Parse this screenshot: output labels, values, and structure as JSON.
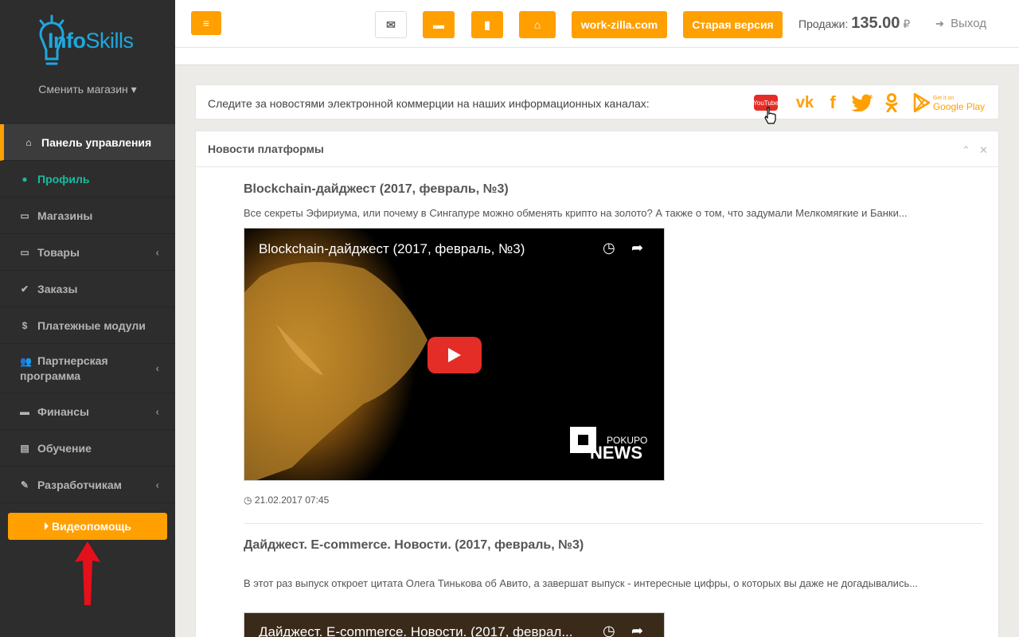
{
  "sidebar": {
    "logo": {
      "info": "Info",
      "skills": "Skills"
    },
    "change_shop": "Сменить магазин ▾",
    "items": [
      {
        "label": "Панель управления",
        "icon": "home-icon"
      },
      {
        "label": "Профиль",
        "icon": "user-icon"
      },
      {
        "label": "Магазины",
        "icon": "cart-icon"
      },
      {
        "label": "Товары",
        "icon": "cart-icon"
      },
      {
        "label": "Заказы",
        "icon": "check-icon"
      },
      {
        "label": "Платежные модули",
        "icon": "dollar-icon"
      },
      {
        "label": "Партнерская программа",
        "icon": "users-icon"
      },
      {
        "label": "Финансы",
        "icon": "archive-icon"
      },
      {
        "label": "Обучение",
        "icon": "book-icon"
      },
      {
        "label": "Разработчикам",
        "icon": "plug-icon"
      }
    ],
    "video_help": "Видеопомощь"
  },
  "topbar": {
    "workzilla": "work-zilla.com",
    "old_version": "Старая версия",
    "sales_label": "Продажи:",
    "sales_value": "135.00",
    "currency": "₽",
    "logout": "Выход"
  },
  "follow": {
    "text": "Следите за новостями электронной коммерции на наших информационных каналах:",
    "youtube": "YouTube",
    "gp_small": "Get it on",
    "gp_big": "Google Play"
  },
  "news": {
    "title": "Новости платформы",
    "articles": [
      {
        "title": "Blockchain-дайджест (2017, февраль, №3)",
        "desc": "Все секреты Эфириума, или почему в Сингапуре можно обменять крипто на золото? А также о том, что задумали Мелкомягкие и Банки...",
        "video_title": "Blockchain-дайджест (2017, февраль, №3)",
        "brand_small": "POKUPO",
        "brand_big": "NEWS",
        "date": "21.02.2017 07:45"
      },
      {
        "title": "Дайджест. E-commerce. Новости. (2017, февраль, №3)",
        "desc": "В этот раз выпуск откроет цитата Олега Тинькова об Авито, а завершат выпуск - интересные цифры, о которых вы даже не догадывались...",
        "video_title": "Дайджест. E-commerce. Новости. (2017, феврал..."
      }
    ]
  },
  "colors": {
    "accent": "#ff9f00",
    "sidebar": "#2d2d2d",
    "profile": "#1abc9c",
    "logo": "#1ea8de"
  }
}
